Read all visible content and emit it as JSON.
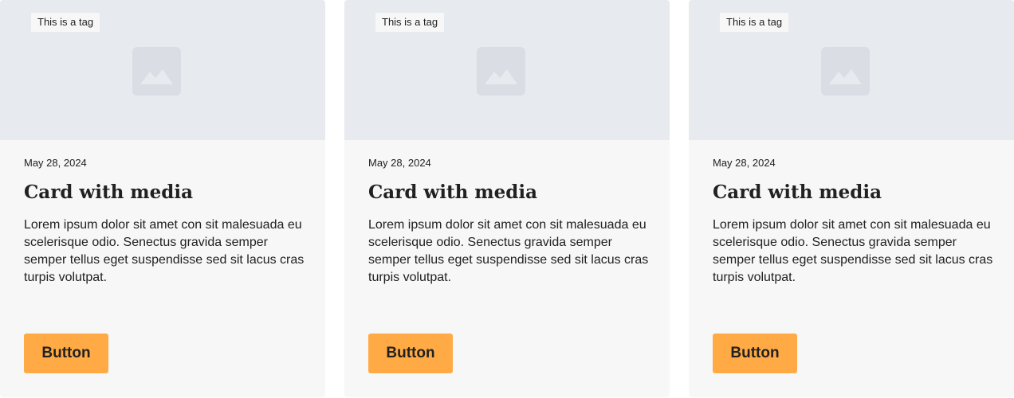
{
  "colors": {
    "card_background": "#f7f7f7",
    "media_background": "#e7eaee",
    "placeholder_icon": "#dadee4",
    "button_background": "#ffaa44",
    "text": "#212121"
  },
  "cards": [
    {
      "tag": "This is a tag",
      "media_icon": "image-placeholder-icon",
      "date": "May 28, 2024",
      "title": "Card with media",
      "description": "Lorem ipsum dolor sit amet con sit malesuada eu scelerisque odio. Senectus gravida semper semper tellus eget suspendisse sed sit lacus cras turpis volutpat.",
      "button_label": "Button"
    },
    {
      "tag": "This is a tag",
      "media_icon": "image-placeholder-icon",
      "date": "May 28, 2024",
      "title": "Card with media",
      "description": "Lorem ipsum dolor sit amet con sit malesuada eu scelerisque odio. Senectus gravida semper semper tellus eget suspendisse sed sit lacus cras turpis volutpat.",
      "button_label": "Button"
    },
    {
      "tag": "This is a tag",
      "media_icon": "image-placeholder-icon",
      "date": "May 28, 2024",
      "title": "Card with media",
      "description": "Lorem ipsum dolor sit amet con sit malesuada eu scelerisque odio. Senectus gravida semper semper tellus eget suspendisse sed sit lacus cras turpis volutpat.",
      "button_label": "Button"
    }
  ]
}
